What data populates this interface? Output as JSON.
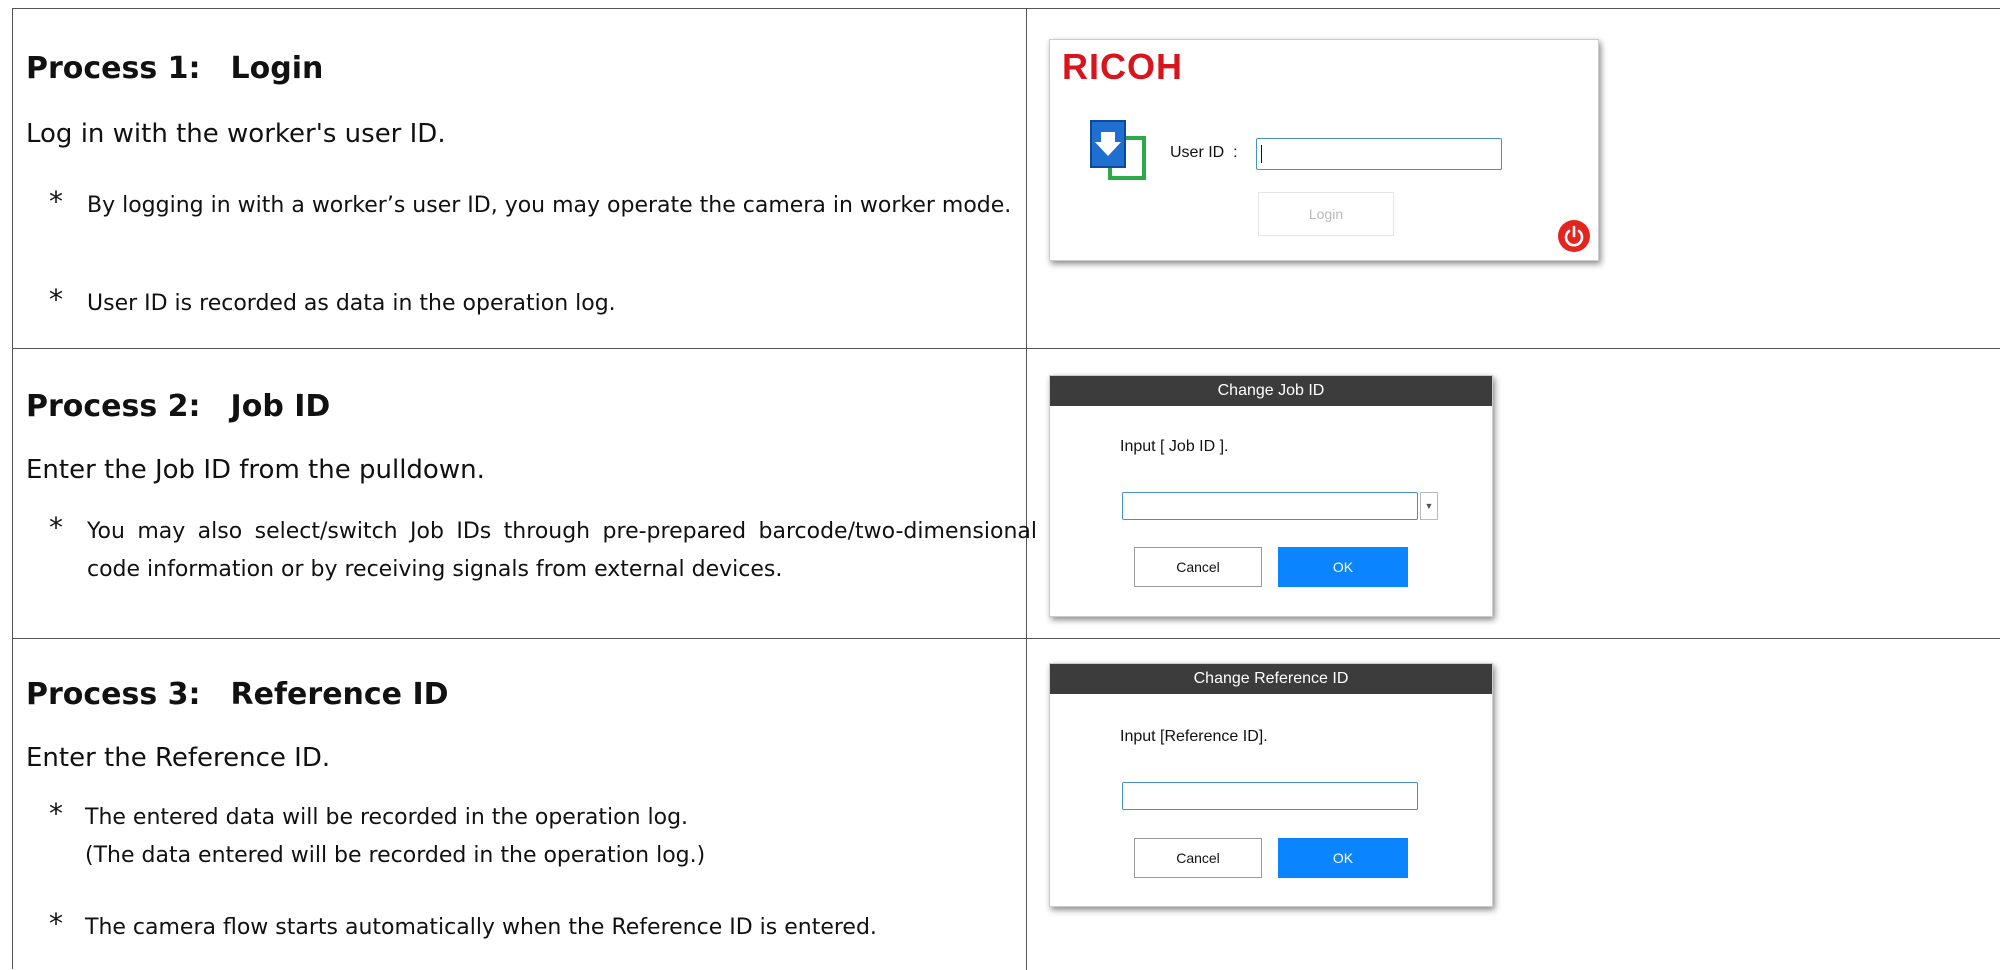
{
  "rows": [
    {
      "title": "Process 1:　Login",
      "lead": "Log in with the worker's user ID.",
      "notes": [
        "By logging in with a worker’s user ID, you may operate the camera in worker mode.",
        "User ID is recorded as data in the operation log."
      ]
    },
    {
      "title": "Process 2:　Job ID",
      "lead": "Enter the Job ID from the pulldown.",
      "notes": [
        "You may also select/switch Job IDs through pre-prepared barcode/two-dimensional code information or by receiving signals from external devices."
      ]
    },
    {
      "title": "Process 3:　Reference ID",
      "lead": "Enter the Reference ID.",
      "notes": [
        "The entered data will be recorded in the operation log.",
        "(The data entered will be recorded in the operation log.)",
        "The camera flow starts automatically when the Reference ID is entered."
      ]
    }
  ],
  "star": "*",
  "login_screen": {
    "logo": "RICOH",
    "user_id_label": "User ID  :",
    "user_id_value": "",
    "login_button": "Login",
    "power_icon": "power-icon",
    "app_icon": "camera-app-icon",
    "colors": {
      "logo": "#d8141d",
      "power": "#e52420"
    }
  },
  "job_dialog": {
    "title": "Change Job ID",
    "prompt": "Input [ Job ID ].",
    "value": "",
    "cancel": "Cancel",
    "ok": "OK"
  },
  "ref_dialog": {
    "title": "Change Reference ID",
    "prompt": "Input [Reference ID].",
    "value": "",
    "cancel": "Cancel",
    "ok": "OK"
  },
  "colors": {
    "ok_button": "#0a84ff",
    "dialog_title_bar": "#3c3c3c"
  }
}
